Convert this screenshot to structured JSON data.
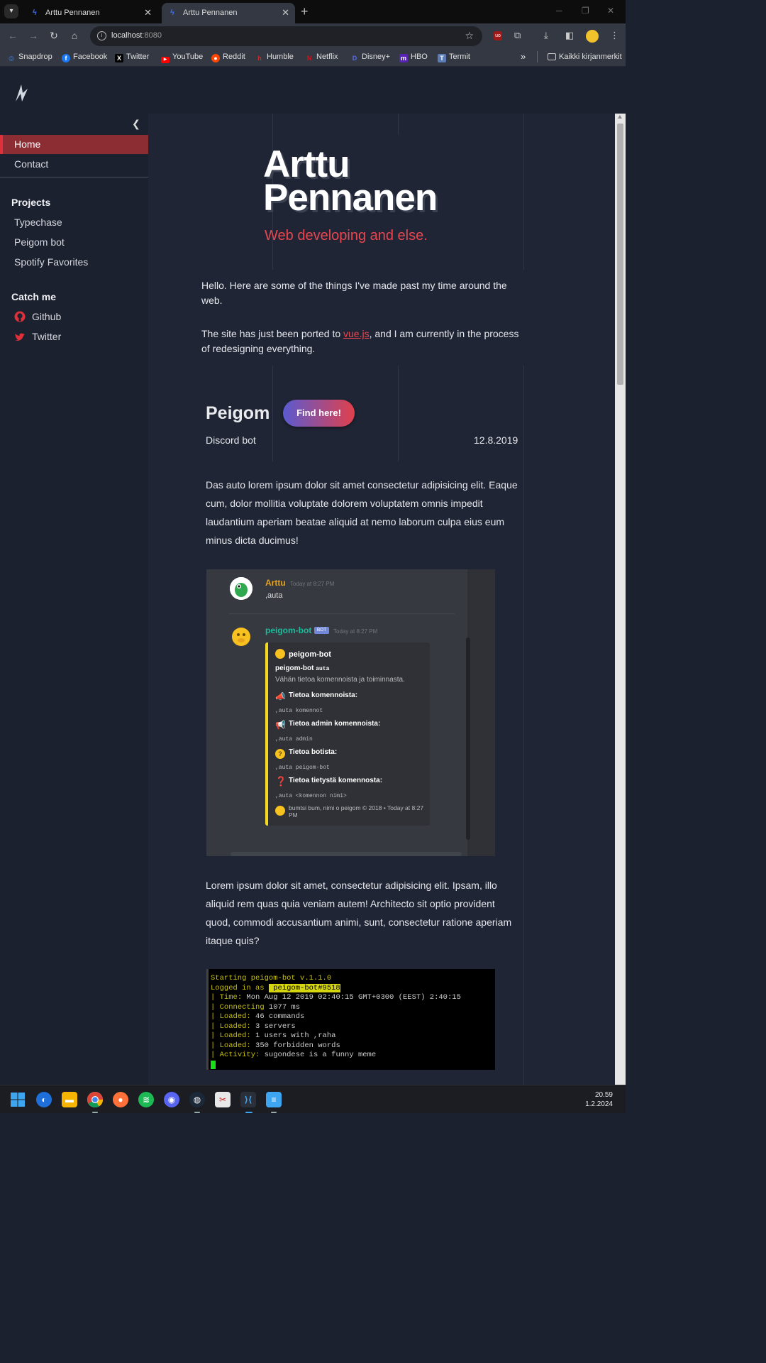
{
  "browser": {
    "tabs": [
      {
        "title": "Arttu Pennanen"
      },
      {
        "title": "Arttu Pennanen"
      }
    ],
    "url_host": "localhost",
    "url_port": ":8080",
    "bookmarks": [
      {
        "label": "Snapdrop",
        "icon": "snapdrop-icon",
        "color": "#3b82f6"
      },
      {
        "label": "Facebook",
        "icon": "facebook-icon",
        "color": "#1877f2"
      },
      {
        "label": "Twitter",
        "icon": "x-icon",
        "color": "#000000"
      },
      {
        "label": "YouTube",
        "icon": "youtube-icon",
        "color": "#ff0000"
      },
      {
        "label": "Reddit",
        "icon": "reddit-icon",
        "color": "#ff4500"
      },
      {
        "label": "Humble",
        "icon": "humble-icon",
        "color": "#cc2929"
      },
      {
        "label": "Netflix",
        "icon": "netflix-icon",
        "color": "#e50914"
      },
      {
        "label": "Disney+",
        "icon": "disney-icon",
        "color": "#113ccf"
      },
      {
        "label": "HBO",
        "icon": "hbo-icon",
        "color": "#5822b4"
      },
      {
        "label": "Termit",
        "icon": "termit-icon",
        "color": "#5b7bb5"
      }
    ],
    "all_bookmarks_label": "Kaikki kirjanmerkit"
  },
  "sidebar": {
    "nav": [
      {
        "label": "Home",
        "active": true
      },
      {
        "label": "Contact",
        "active": false
      }
    ],
    "projects_heading": "Projects",
    "projects": [
      "Typechase",
      "Peigom bot",
      "Spotify Favorites"
    ],
    "catch_heading": "Catch me",
    "social": [
      {
        "label": "Github",
        "icon": "github-icon"
      },
      {
        "label": "Twitter",
        "icon": "twitter-icon"
      }
    ]
  },
  "hero": {
    "title_line1": "Arttu",
    "title_line2": "Pennanen",
    "subtitle": "Web developing and else."
  },
  "intro": {
    "p1": "Hello. Here are some of the things I've made past my time around the web.",
    "p2_before": "The site has just been ported to ",
    "p2_link": "vue.js",
    "p2_after": ", and I am currently in the process of redesigning everything."
  },
  "project": {
    "title": "Peigom",
    "button": "Find here!",
    "kind": "Discord bot",
    "date": "12.8.2019",
    "text1": "Das auto lorem ipsum dolor sit amet consectetur adipisicing elit. Eaque cum, dolor mollitia voluptate dolorem voluptatem omnis impedit laudantium aperiam beatae aliquid at nemo laborum culpa eius eum minus dicta ducimus!",
    "text2": "Lorem ipsum dolor sit amet, consectetur adipisicing elit. Ipsam, illo aliquid rem quas quia veniam autem! Architecto sit optio provident quod, commodi accusantium animi, sunt, consectetur ratione aperiam itaque quis?"
  },
  "discord": {
    "user1": "Arttu",
    "time1": "Today at 8:27 PM",
    "msg1": ",auta",
    "user2": "peigom-bot",
    "badge": "BOT",
    "time2": "Today at 8:27 PM",
    "embed_author": "peigom-bot",
    "embed_title": "peigom-bot",
    "embed_title_code": "auta",
    "embed_desc": "Vähän tietoa komennoista ja toiminnasta.",
    "fields": [
      {
        "name": "Tietoa komennoista:",
        "value": ",auta komennot"
      },
      {
        "name": "Tietoa admin komennoista:",
        "value": ",auta admin"
      },
      {
        "name": "Tietoa botista:",
        "value": ",auta peigom-bot"
      },
      {
        "name": "Tietoa tietystä komennosta:",
        "value": ",auta <komennon nimi>"
      }
    ],
    "footer": "bumtsi bum, nimi o peigom © 2018 • Today at 8:27 PM"
  },
  "terminal": {
    "l1": "Starting peigom-bot v.1.1.0",
    "l2_prefix": "Logged in as ",
    "l2_hl": " peigom-bot#9518",
    "rows": [
      {
        "key": "Time:",
        "val": " Mon Aug 12 2019 02:40:15 GMT+0300 (EEST) 2:40:15"
      },
      {
        "key": "Connecting",
        "val": " 1077 ms"
      },
      {
        "key": "Loaded:",
        "val": " 46 commands"
      },
      {
        "key": "Loaded:",
        "val": " 3 servers"
      },
      {
        "key": "Loaded:",
        "val": " 1 users with ,raha"
      },
      {
        "key": "Loaded:",
        "val": " 350 forbidden words"
      },
      {
        "key": "Activity:",
        "val": " sugondese is a funny meme"
      }
    ]
  },
  "taskbar": {
    "time": "20.59",
    "date": "1.2.2024"
  },
  "colors": {
    "accent": "#e8474f",
    "sidebar_active": "#8c2d33",
    "background": "#202535"
  }
}
